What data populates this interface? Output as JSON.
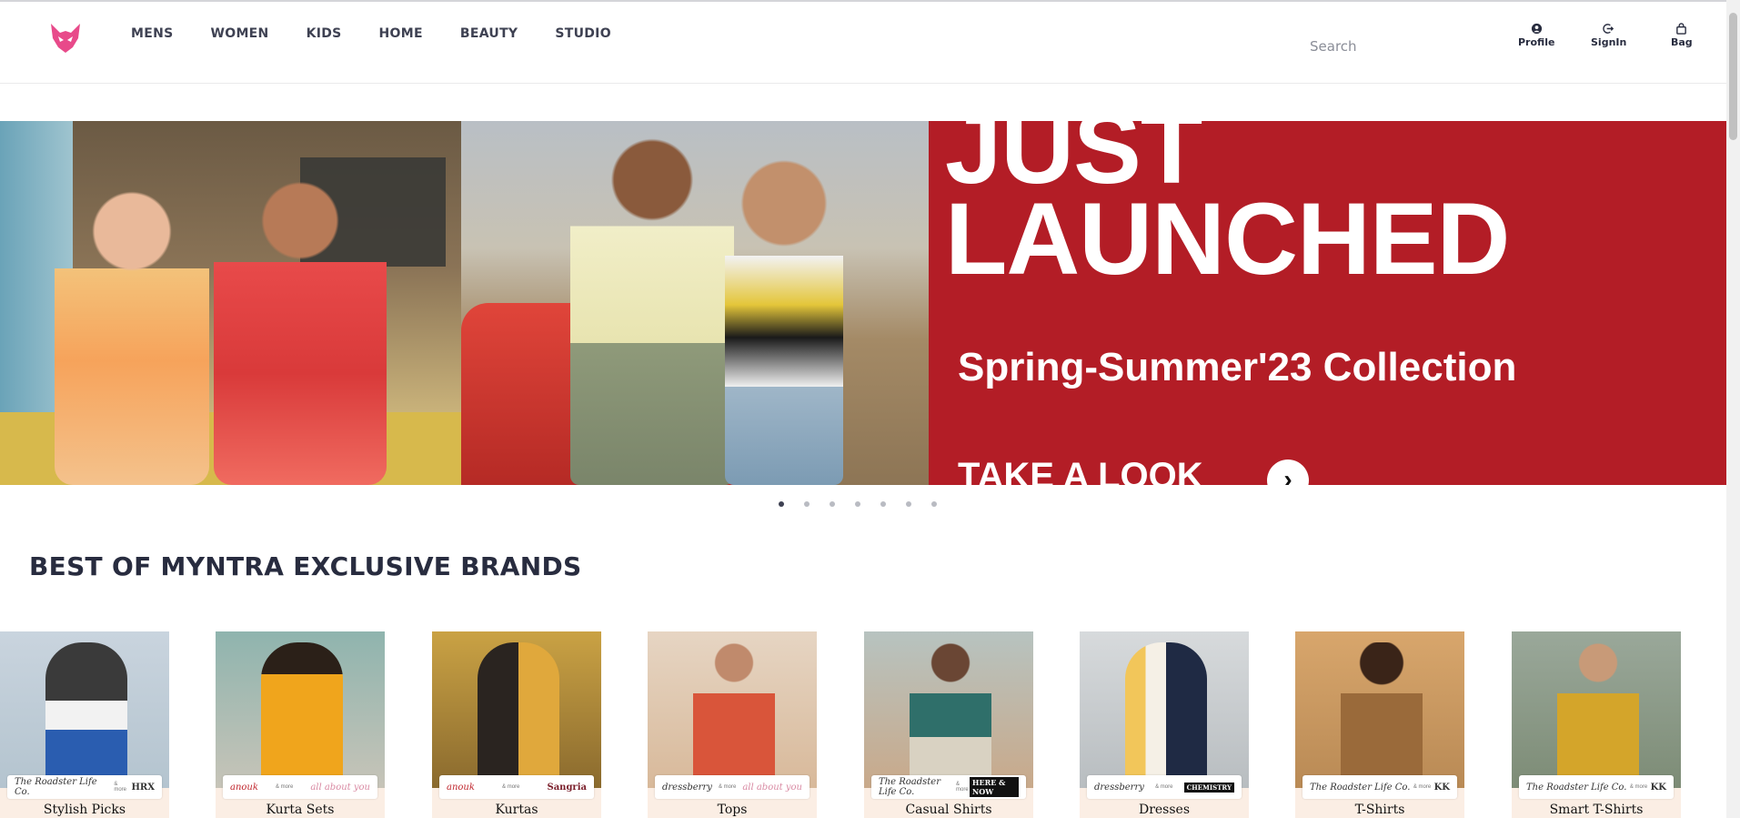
{
  "header": {
    "nav": [
      "MENS",
      "WOMEN",
      "KIDS",
      "HOME",
      "BEAUTY",
      "STUDIO"
    ],
    "search_placeholder": "Search",
    "actions": [
      {
        "label": "Profile",
        "icon": "user-icon"
      },
      {
        "label": "SignIn",
        "icon": "signin-icon"
      },
      {
        "label": "Bag",
        "icon": "bag-icon"
      }
    ]
  },
  "colors": {
    "brand": "#e84a8a",
    "banner_red": "#b31d26"
  },
  "banner": {
    "title_line1": "JUST",
    "title_line2": "LAUNCHED",
    "subtitle": "Spring-Summer'23 Collection",
    "cta": "TAKE A LOOK",
    "slide_count": 7,
    "active_slide": 1
  },
  "section": {
    "title": "BEST OF MYNTRA EXCLUSIVE BRANDS"
  },
  "cards": [
    {
      "label": "Stylish Picks",
      "logo_left": "The Roadster Life Co.",
      "logo_right": "HRX"
    },
    {
      "label": "Kurta Sets",
      "logo_left": "anouk",
      "logo_right": "all about you"
    },
    {
      "label": "Kurtas",
      "logo_left": "anouk",
      "logo_right": "Sangria"
    },
    {
      "label": "Tops",
      "logo_left": "dressberry",
      "logo_right": "all about you"
    },
    {
      "label": "Casual Shirts",
      "logo_left": "The Roadster Life Co.",
      "logo_right": "HERE & NOW"
    },
    {
      "label": "Dresses",
      "logo_left": "dressberry",
      "logo_right": "CHEMISTRY"
    },
    {
      "label": "T-Shirts",
      "logo_left": "The Roadster Life Co.",
      "logo_right": "KK"
    },
    {
      "label": "Smart T-Shirts",
      "logo_left": "The Roadster Life Co.",
      "logo_right": "KK"
    }
  ],
  "logo_more_text": "& more"
}
